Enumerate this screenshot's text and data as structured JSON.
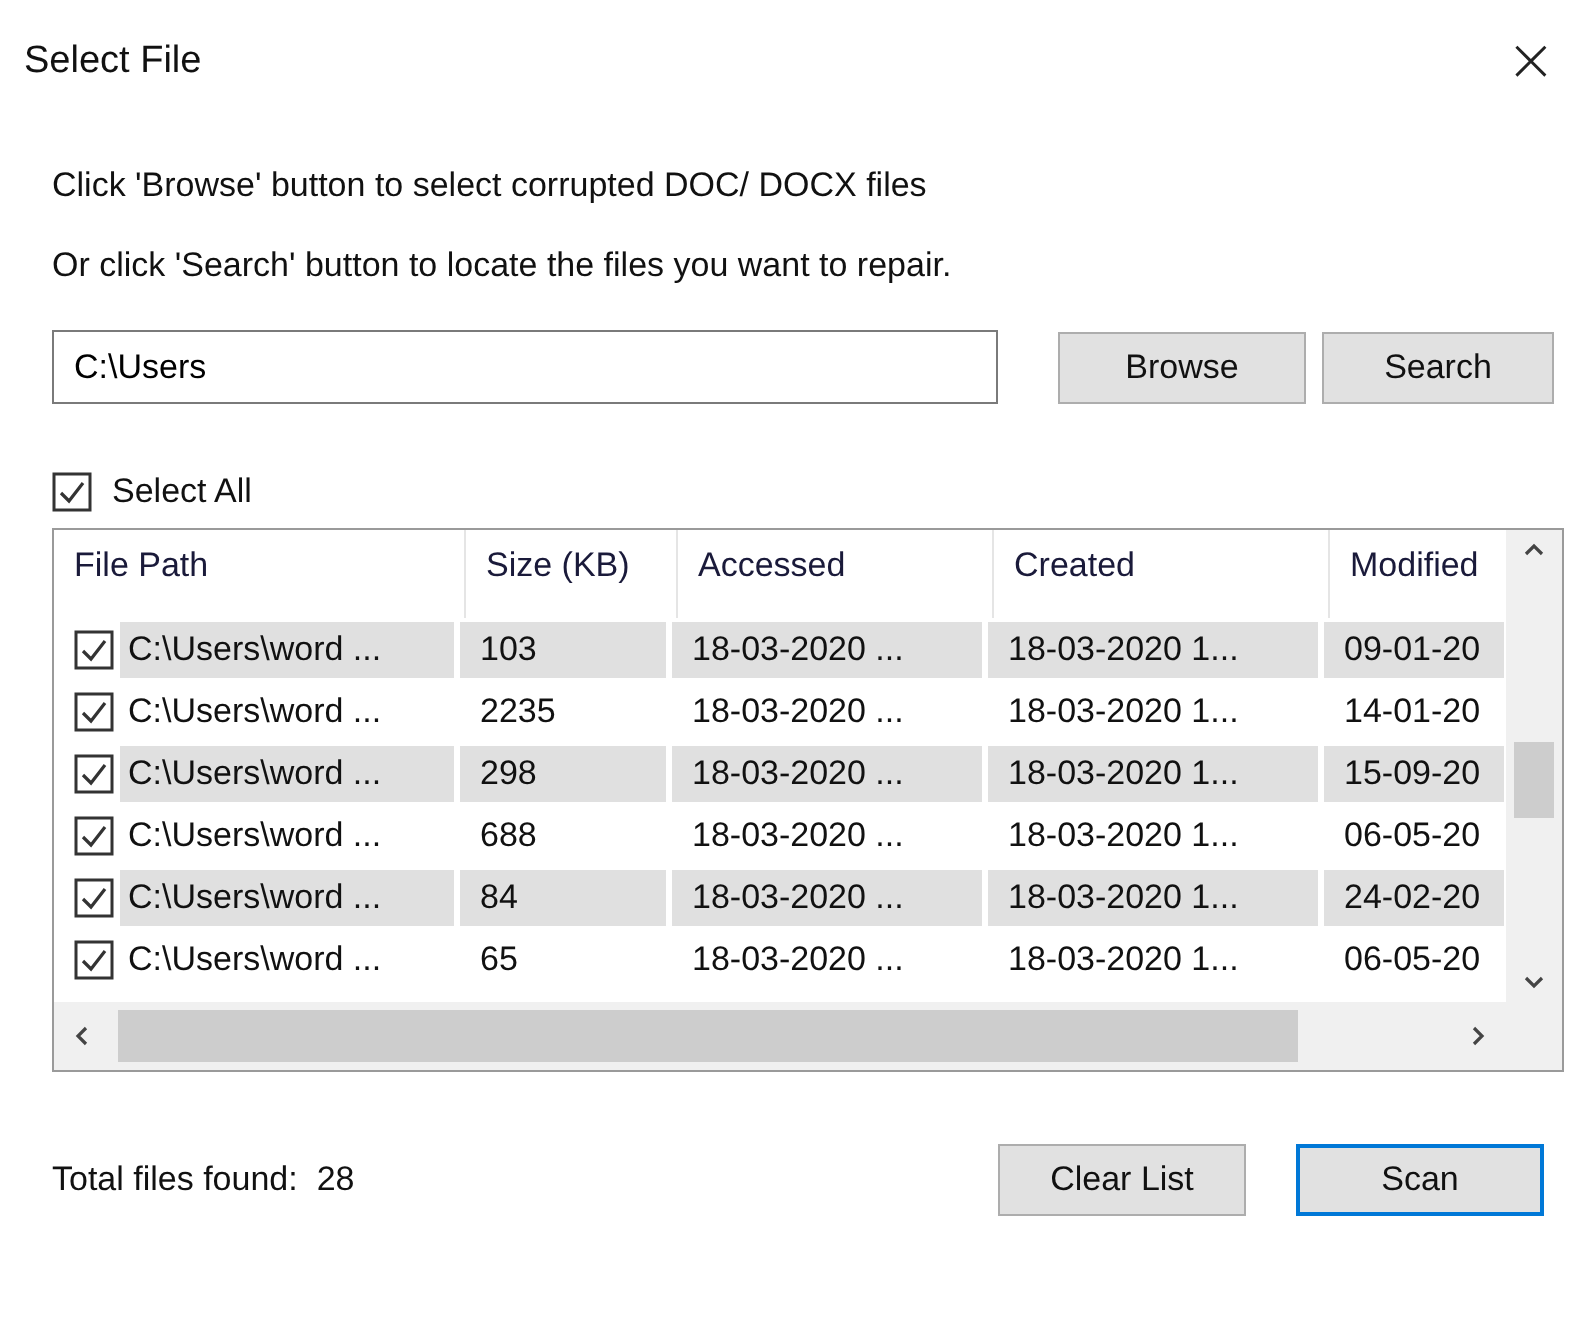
{
  "window": {
    "title": "Select File",
    "close": "×"
  },
  "instructions": [
    "Click 'Browse' button to select corrupted DOC/ DOCX files",
    "Or click 'Search' button to locate the files you want to repair."
  ],
  "path_field": {
    "value": "C:\\Users"
  },
  "buttons_top": [
    "Browse",
    "Search"
  ],
  "select_all": {
    "label": "Select All",
    "checked": true
  },
  "table": {
    "columns": [
      "File Path",
      "Size (KB)",
      "Accessed",
      "Created",
      "Modified"
    ],
    "rows": [
      {
        "checked": true,
        "cells": [
          "C:\\Users\\word ...",
          "103",
          "18-03-2020 ...",
          "18-03-2020 1...",
          "09-01-20"
        ]
      },
      {
        "checked": true,
        "cells": [
          "C:\\Users\\word ...",
          "2235",
          "18-03-2020 ...",
          "18-03-2020 1...",
          "14-01-20"
        ]
      },
      {
        "checked": true,
        "cells": [
          "C:\\Users\\word ...",
          "298",
          "18-03-2020 ...",
          "18-03-2020 1...",
          "15-09-20"
        ]
      },
      {
        "checked": true,
        "cells": [
          "C:\\Users\\word ...",
          "688",
          "18-03-2020 ...",
          "18-03-2020 1...",
          "06-05-20"
        ]
      },
      {
        "checked": true,
        "cells": [
          "C:\\Users\\word ...",
          "84",
          "18-03-2020 ...",
          "18-03-2020 1...",
          "24-02-20"
        ]
      },
      {
        "checked": true,
        "cells": [
          "C:\\Users\\word ...",
          "65",
          "18-03-2020 ...",
          "18-03-2020 1...",
          "06-05-20"
        ]
      }
    ]
  },
  "footer": {
    "label": "Total files found:",
    "count": "28"
  },
  "buttons_bottom": [
    {
      "label": "Clear List",
      "default": false
    },
    {
      "label": "Scan",
      "default": true
    }
  ]
}
